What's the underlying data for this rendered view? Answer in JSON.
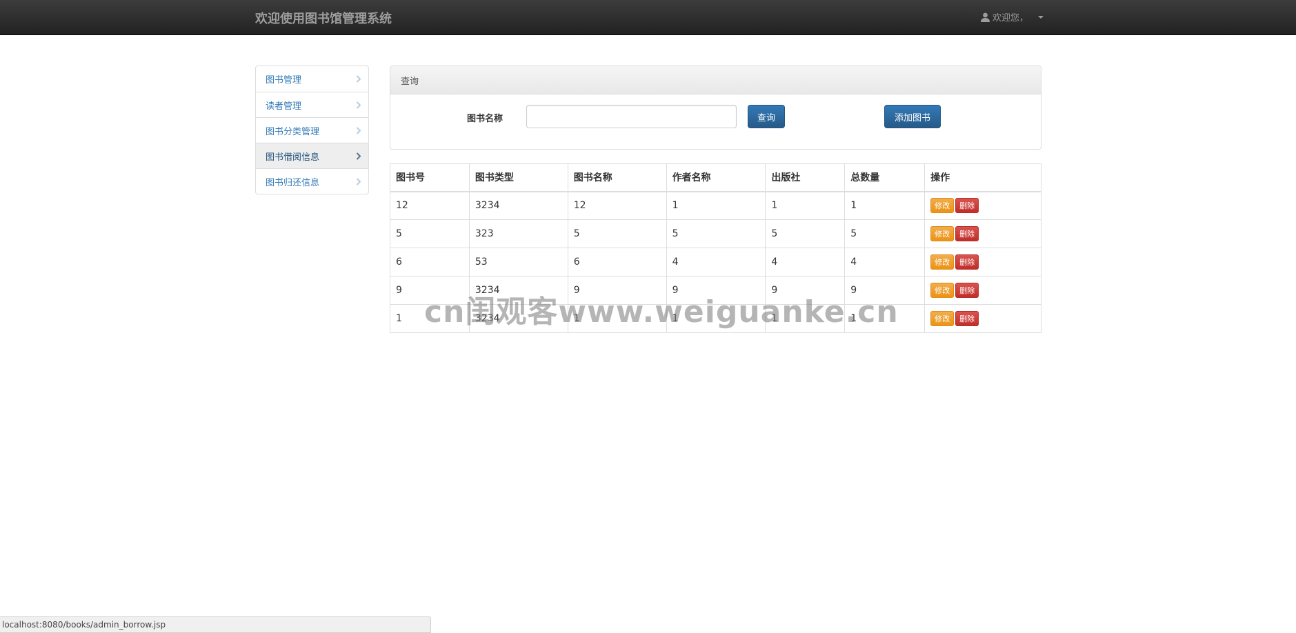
{
  "navbar": {
    "brand": "欢迎使用图书馆管理系统",
    "user_greeting": "欢迎您，",
    "user_icon": "user-icon"
  },
  "sidebar": {
    "items": [
      {
        "label": "图书管理",
        "active": false
      },
      {
        "label": "读者管理",
        "active": false
      },
      {
        "label": "图书分类管理",
        "active": false
      },
      {
        "label": "图书借阅信息",
        "active": true
      },
      {
        "label": "图书归还信息",
        "active": false
      }
    ]
  },
  "query_panel": {
    "heading": "查询",
    "field_label": "图书名称",
    "input_value": "",
    "query_button": "查询",
    "add_button": "添加图书"
  },
  "table": {
    "headers": [
      "图书号",
      "图书类型",
      "图书名称",
      "作者名称",
      "出版社",
      "总数量",
      "操作"
    ],
    "rows": [
      [
        "12",
        "3234",
        "12",
        "1",
        "1",
        "1"
      ],
      [
        "5",
        "323",
        "5",
        "5",
        "5",
        "5"
      ],
      [
        "6",
        "53",
        "6",
        "4",
        "4",
        "4"
      ],
      [
        "9",
        "3234",
        "9",
        "9",
        "9",
        "9"
      ],
      [
        "1",
        "3234",
        "1",
        "1",
        "1",
        "1"
      ]
    ],
    "edit_label": "修改",
    "delete_label": "删除"
  },
  "watermark": "cn闺观客www.weiguanke.cn",
  "statusbar": {
    "url": "localhost:8080/books/admin_borrow.jsp"
  },
  "colors": {
    "navbar": "#222222",
    "link": "#337ab7",
    "primary": "#337ab7",
    "warning": "#f0ad4e",
    "danger": "#d9534f"
  }
}
